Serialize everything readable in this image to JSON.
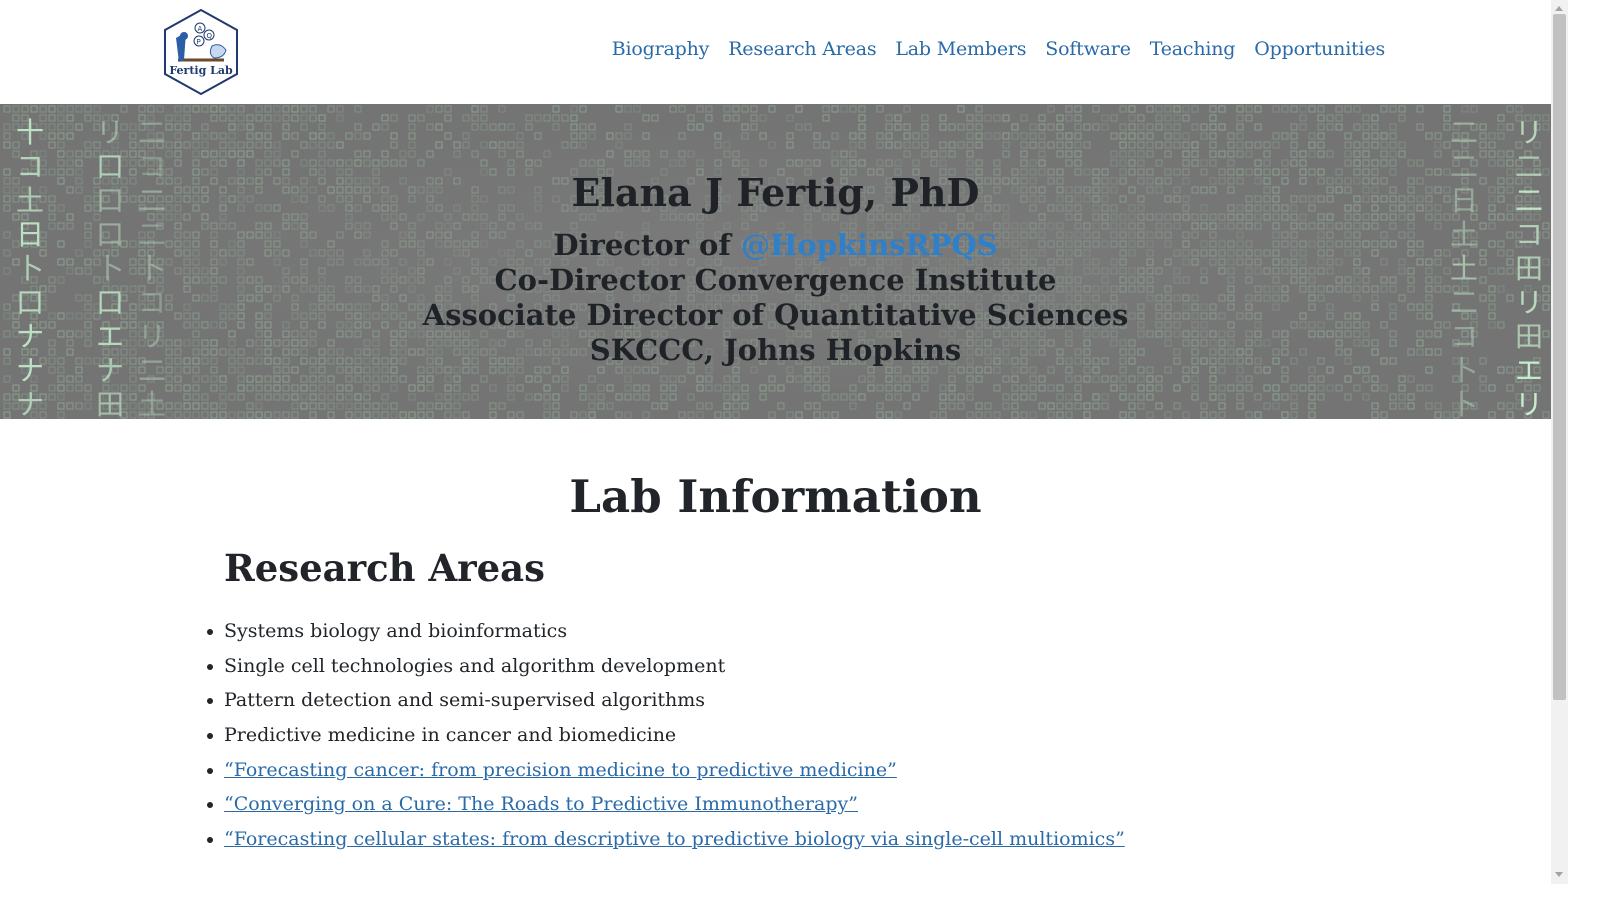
{
  "logo": {
    "text": "Fertig Lab",
    "letters": [
      "A",
      "P",
      "Q"
    ]
  },
  "nav": [
    {
      "label": "Biography",
      "name": "nav-biography"
    },
    {
      "label": "Research Areas",
      "name": "nav-research-areas"
    },
    {
      "label": "Lab Members",
      "name": "nav-lab-members"
    },
    {
      "label": "Software",
      "name": "nav-software"
    },
    {
      "label": "Teaching",
      "name": "nav-teaching"
    },
    {
      "label": "Opportunities",
      "name": "nav-opportunities"
    }
  ],
  "hero": {
    "name": "Elana J Fertig, PhD",
    "director_prefix": "Director of ",
    "handle": "@HopkinsRPQS",
    "line2": "Co-Director Convergence Institute",
    "line3": "Associate Director of Quantitative Sciences",
    "line4": "SKCCC, Johns Hopkins"
  },
  "main": {
    "title": "Lab Information",
    "research_heading": "Research Areas",
    "research_items": [
      {
        "text": "Systems biology and bioinformatics",
        "link": false
      },
      {
        "text": "Single cell technologies and algorithm development",
        "link": false
      },
      {
        "text": "Pattern detection and semi-supervised algorithms",
        "link": false
      },
      {
        "text": "Predictive medicine in cancer and biomedicine",
        "link": false
      },
      {
        "text": "“Forecasting cancer: from precision medicine to predictive medicine”",
        "link": true
      },
      {
        "text": "“Converging on a Cure: The Roads to Predictive Immunotherapy”",
        "link": true
      },
      {
        "text": "“Forecasting cellular states: from descriptive to predictive biology via single-cell multiomics”",
        "link": true
      }
    ]
  },
  "colors": {
    "link": "#2a6aa8",
    "handle": "#2f7fc9",
    "heading": "#212529",
    "hero_bg": "#7a7a7a",
    "matrix_glyph": "#a8d8b0"
  }
}
